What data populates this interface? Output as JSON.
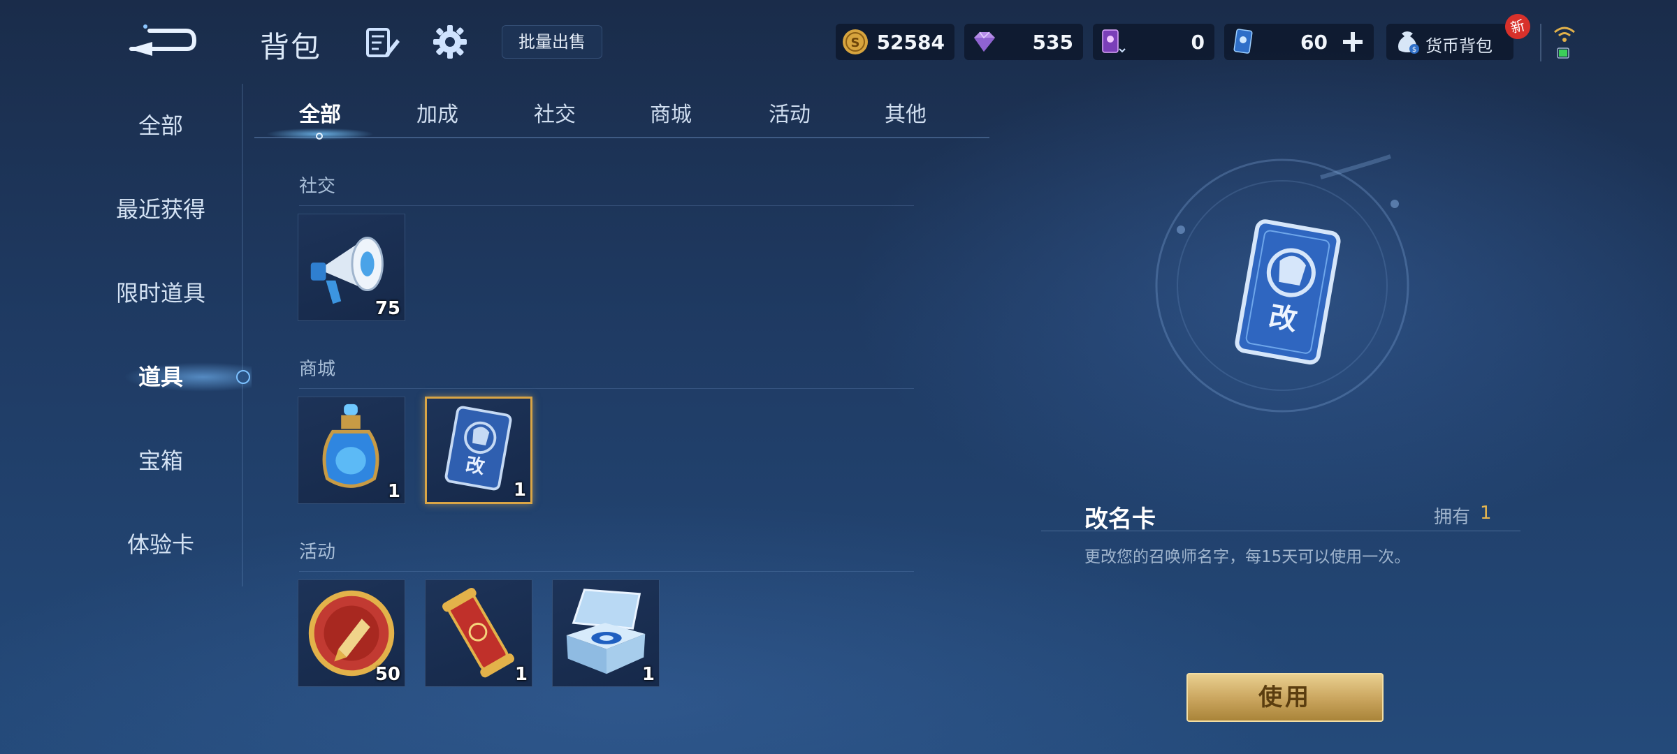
{
  "header": {
    "title": "背包",
    "bulk_sell_label": "批量出售",
    "currencies": {
      "gold": "52584",
      "gems": "535",
      "cards": "0",
      "vouchers": "60"
    },
    "wallet_label": "货币背包",
    "new_badge": "新"
  },
  "sidebar": {
    "items": [
      {
        "label": "全部"
      },
      {
        "label": "最近获得"
      },
      {
        "label": "限时道具"
      },
      {
        "label": "道具"
      },
      {
        "label": "宝箱"
      },
      {
        "label": "体验卡"
      }
    ],
    "active_index": 3
  },
  "tabs": {
    "items": [
      {
        "label": "全部"
      },
      {
        "label": "加成"
      },
      {
        "label": "社交"
      },
      {
        "label": "商城"
      },
      {
        "label": "活动"
      },
      {
        "label": "其他"
      }
    ],
    "active_index": 0
  },
  "sections": [
    {
      "title": "社交",
      "items": [
        {
          "icon": "megaphone-icon",
          "count": "75"
        }
      ]
    },
    {
      "title": "商城",
      "items": [
        {
          "icon": "potion-bottle-icon",
          "count": "1"
        },
        {
          "icon": "rename-card-icon",
          "count": "1",
          "selected": true
        }
      ]
    },
    {
      "title": "活动",
      "items": [
        {
          "icon": "quill-pen-coin-icon",
          "count": "50"
        },
        {
          "icon": "red-scroll-icon",
          "count": "1"
        },
        {
          "icon": "crystal-box-icon",
          "count": "1"
        }
      ]
    }
  ],
  "detail": {
    "name": "改名卡",
    "owned_label": "拥有",
    "owned_count": "1",
    "description": "更改您的召唤师名字，每15天可以使用一次。",
    "card_glyph": "改",
    "use_label": "使用"
  },
  "colors": {
    "accent_gold": "#d9a546",
    "owned_count": "#e7b64e",
    "active_glow": "#7cc1ff",
    "new_badge": "#d8312b"
  }
}
